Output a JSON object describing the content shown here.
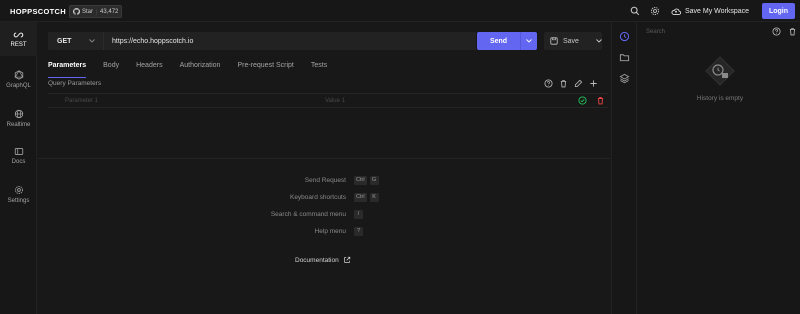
{
  "app": {
    "logo": "HOPPSCOTCH",
    "github": {
      "star_label": "Star",
      "count": "43,472"
    },
    "save_workspace": "Save My Workspace",
    "login": "Login"
  },
  "sidebar": {
    "items": [
      {
        "label": "REST",
        "icon": "rest-icon"
      },
      {
        "label": "GraphQL",
        "icon": "graphql-icon"
      },
      {
        "label": "Realtime",
        "icon": "globe-icon"
      },
      {
        "label": "Docs",
        "icon": "book-icon"
      },
      {
        "label": "Settings",
        "icon": "gear-icon"
      }
    ]
  },
  "request": {
    "method": "GET",
    "url": "https://echo.hoppscotch.io",
    "send_label": "Send",
    "save_label": "Save"
  },
  "tabs": [
    "Parameters",
    "Body",
    "Headers",
    "Authorization",
    "Pre-request Script",
    "Tests"
  ],
  "query": {
    "heading": "Query Parameters",
    "key_placeholder": "Parameter 1",
    "value_placeholder": "Value 1"
  },
  "shortcuts": [
    {
      "label": "Send Request",
      "keys": [
        "Ctrl",
        "G"
      ]
    },
    {
      "label": "Keyboard shortcuts",
      "keys": [
        "Ctrl",
        "K"
      ]
    },
    {
      "label": "Search & command menu",
      "keys": [
        "/"
      ]
    },
    {
      "label": "Help menu",
      "keys": [
        "?"
      ]
    }
  ],
  "documentation_label": "Documentation",
  "history": {
    "search_placeholder": "Search",
    "empty_text": "History is empty"
  },
  "colors": {
    "accent": "#6366f1",
    "success": "#22c55e",
    "danger": "#ef4444",
    "background": "#181818"
  }
}
